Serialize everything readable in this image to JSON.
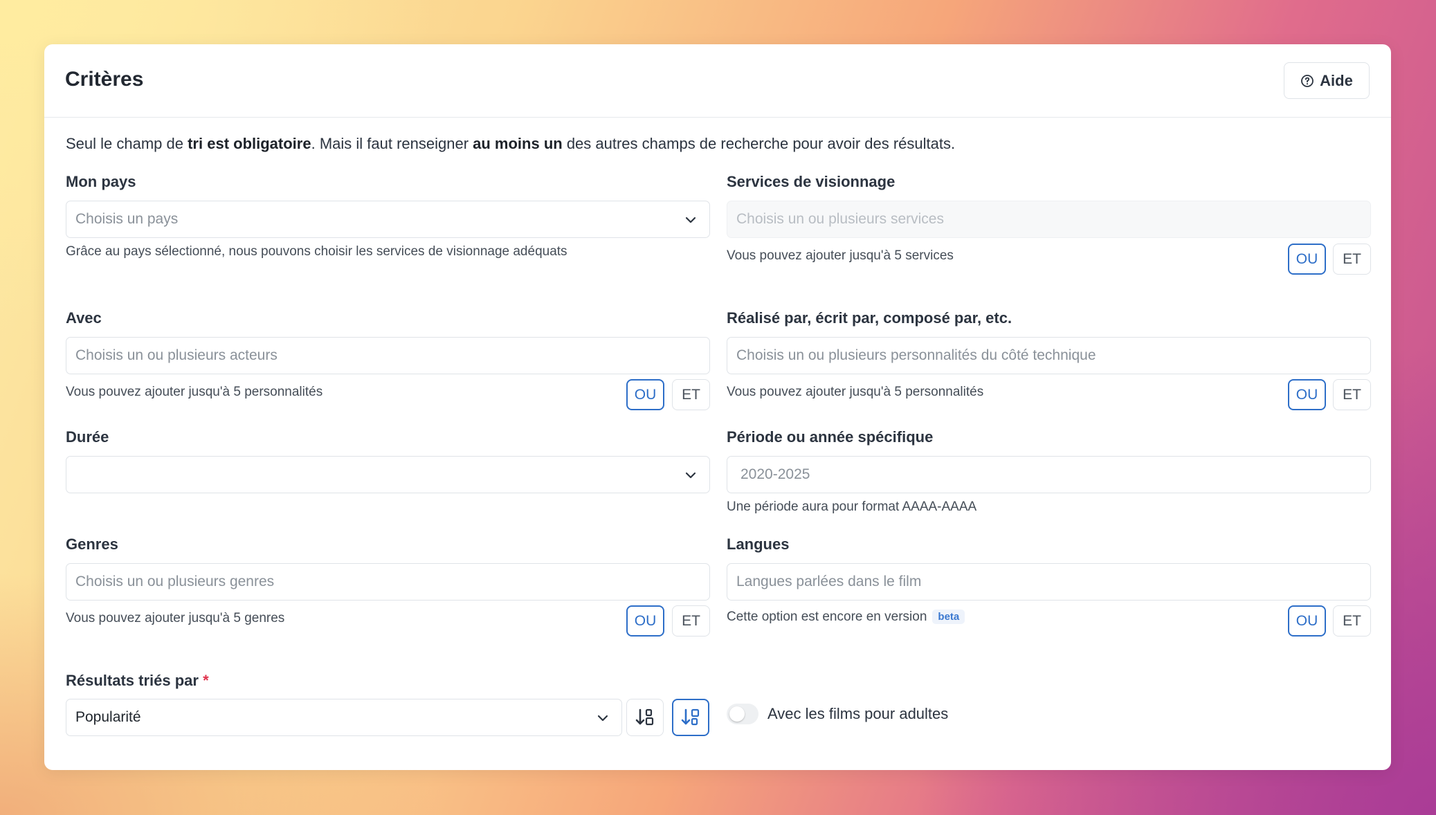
{
  "card": {
    "title": "Critères",
    "help_label": "Aide"
  },
  "intro": {
    "part1": "Seul le champ de ",
    "bold1": "tri est obligatoire",
    "part2": ". Mais il faut renseigner ",
    "bold2": "au moins un",
    "part3": " des autres champs de recherche pour avoir des résultats."
  },
  "country": {
    "label": "Mon pays",
    "placeholder": "Choisis un pays",
    "help": "Grâce au pays sélectionné, nous pouvons choisir les services de visionnage adéquats"
  },
  "services": {
    "label": "Services de visionnage",
    "placeholder": "Choisis un ou plusieurs services",
    "help": "Vous pouvez ajouter jusqu'à 5 services",
    "or_label": "OU",
    "and_label": "ET",
    "mode": "OU"
  },
  "cast": {
    "label": "Avec",
    "placeholder": "Choisis un ou plusieurs acteurs",
    "help": "Vous pouvez ajouter jusqu'à 5 personnalités",
    "or_label": "OU",
    "and_label": "ET",
    "mode": "OU"
  },
  "crew": {
    "label": "Réalisé par, écrit par, composé par, etc.",
    "placeholder": "Choisis un ou plusieurs personnalités du côté technique",
    "help": "Vous pouvez ajouter jusqu'à 5 personnalités",
    "or_label": "OU",
    "and_label": "ET",
    "mode": "OU"
  },
  "duration": {
    "label": "Durée",
    "value": ""
  },
  "period": {
    "label": "Période ou année spécifique",
    "placeholder": "2020-2025",
    "help": "Une période aura pour format AAAA-AAAA"
  },
  "genres": {
    "label": "Genres",
    "placeholder": "Choisis un ou plusieurs genres",
    "help": "Vous pouvez ajouter jusqu'à 5 genres",
    "or_label": "OU",
    "and_label": "ET",
    "mode": "OU"
  },
  "languages": {
    "label": "Langues",
    "placeholder": "Langues parlées dans le film",
    "help": "Cette option est encore en version",
    "badge": "beta",
    "or_label": "OU",
    "and_label": "ET",
    "mode": "OU"
  },
  "sort": {
    "label": "Résultats triés par",
    "required_mark": "*",
    "value": "Popularité",
    "direction": "descending"
  },
  "adult": {
    "label": "Avec les films pour adultes",
    "enabled": false
  },
  "colors": {
    "accent": "#2d6ec8",
    "required": "#e0334d"
  }
}
